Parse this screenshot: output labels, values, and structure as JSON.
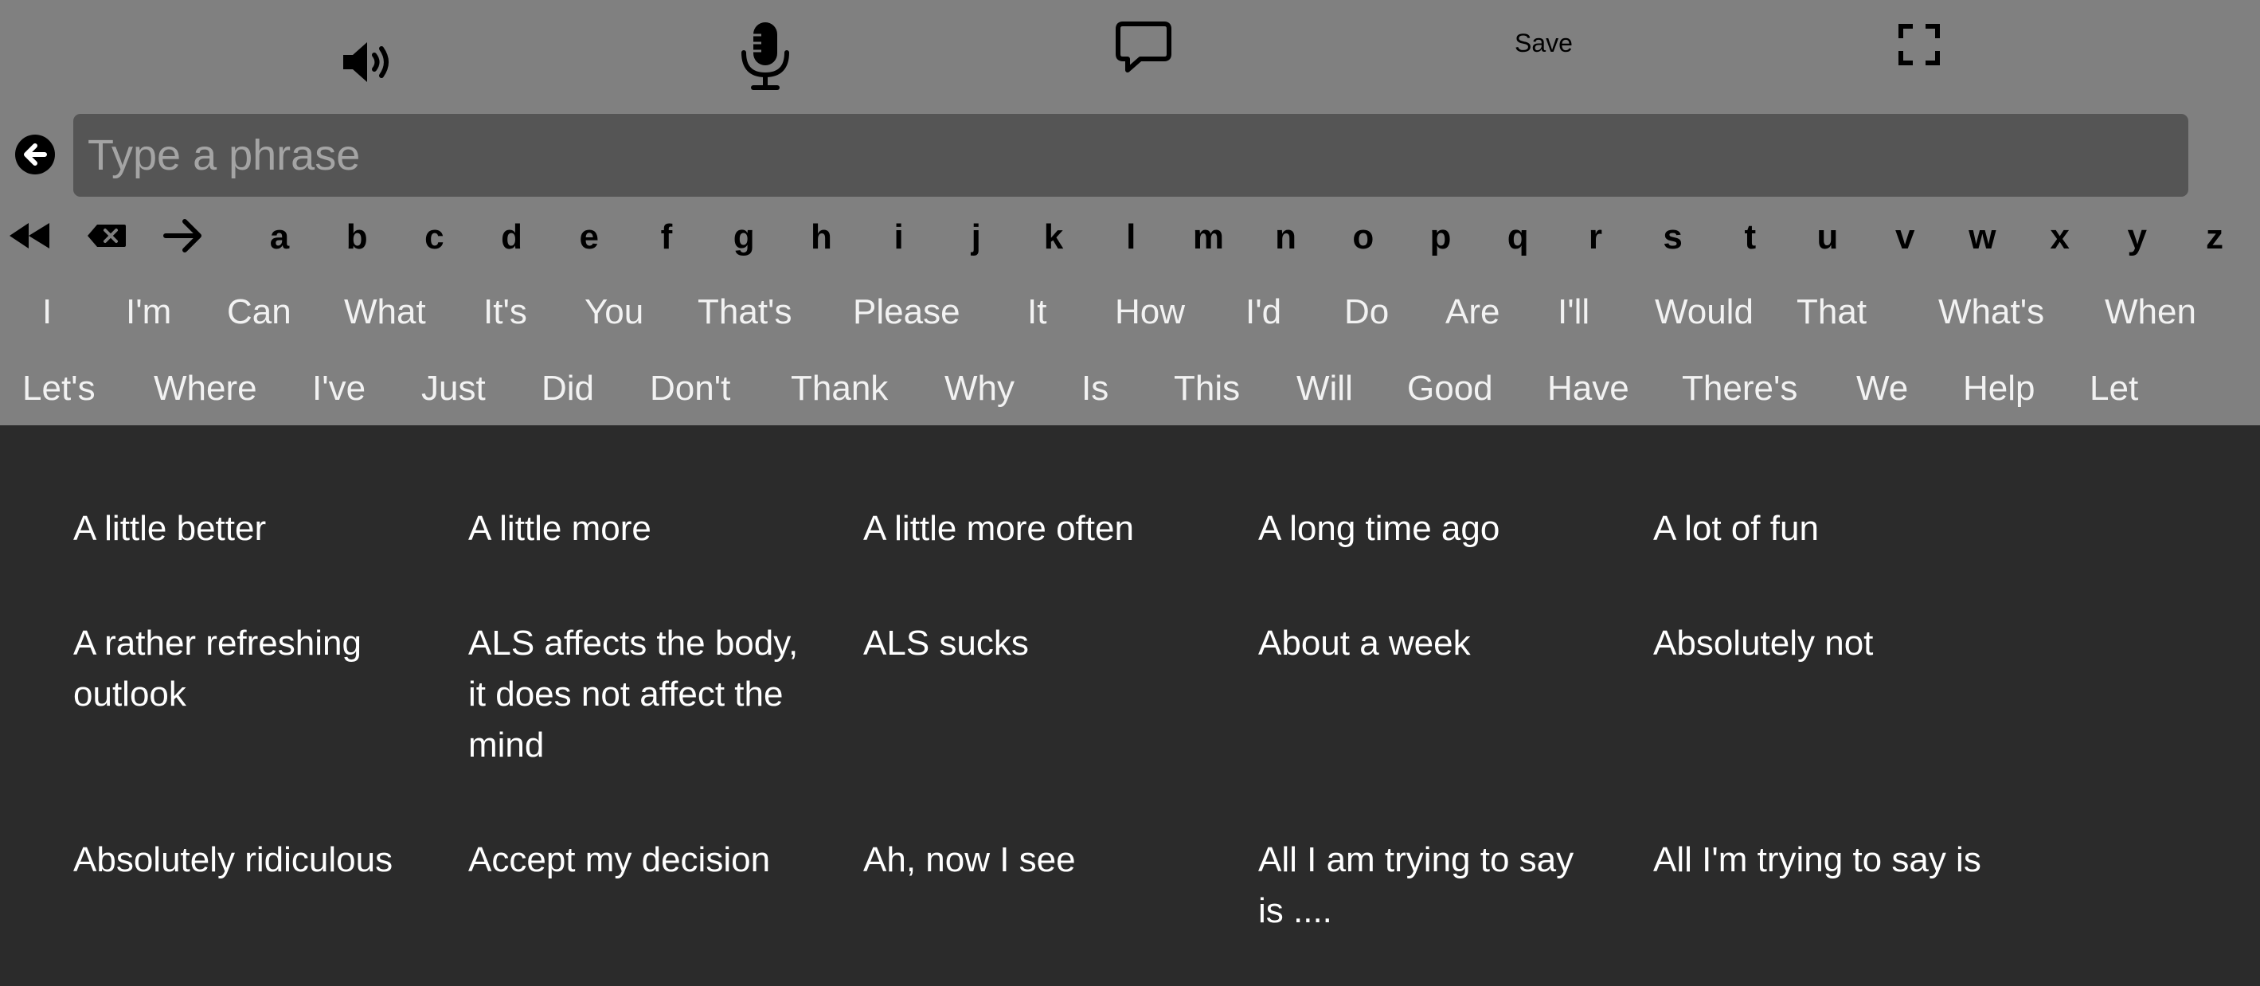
{
  "toolbar": {
    "save_label": "Save"
  },
  "input": {
    "placeholder": "Type a phrase",
    "value": ""
  },
  "letters": [
    "a",
    "b",
    "c",
    "d",
    "e",
    "f",
    "g",
    "h",
    "i",
    "j",
    "k",
    "l",
    "m",
    "n",
    "o",
    "p",
    "q",
    "r",
    "s",
    "t",
    "u",
    "v",
    "w",
    "x",
    "y",
    "z"
  ],
  "word_rows": [
    [
      "I",
      "I'm",
      "Can",
      "What",
      "It's",
      "You",
      "That's",
      "Please",
      "It",
      "How",
      "I'd",
      "Do",
      "Are",
      "I'll",
      "Would",
      "That",
      "What's",
      "When"
    ],
    [
      "Let's",
      "Where",
      "I've",
      "Just",
      "Did",
      "Don't",
      "Thank",
      "Why",
      "Is",
      "This",
      "Will",
      "Good",
      "Have",
      "There's",
      "We",
      "Help",
      "Let"
    ]
  ],
  "phrases": [
    "A little better",
    "A little more",
    "A little more often",
    "A long time ago",
    "A lot of fun",
    "A rather refreshing outlook",
    "ALS affects the body, it does not affect the mind",
    "ALS sucks",
    "About a week",
    "Absolutely not",
    "Absolutely ridiculous",
    "Accept my decision",
    "Ah, now I see",
    "All I am trying to say is ....",
    "All I'm trying to say is"
  ]
}
